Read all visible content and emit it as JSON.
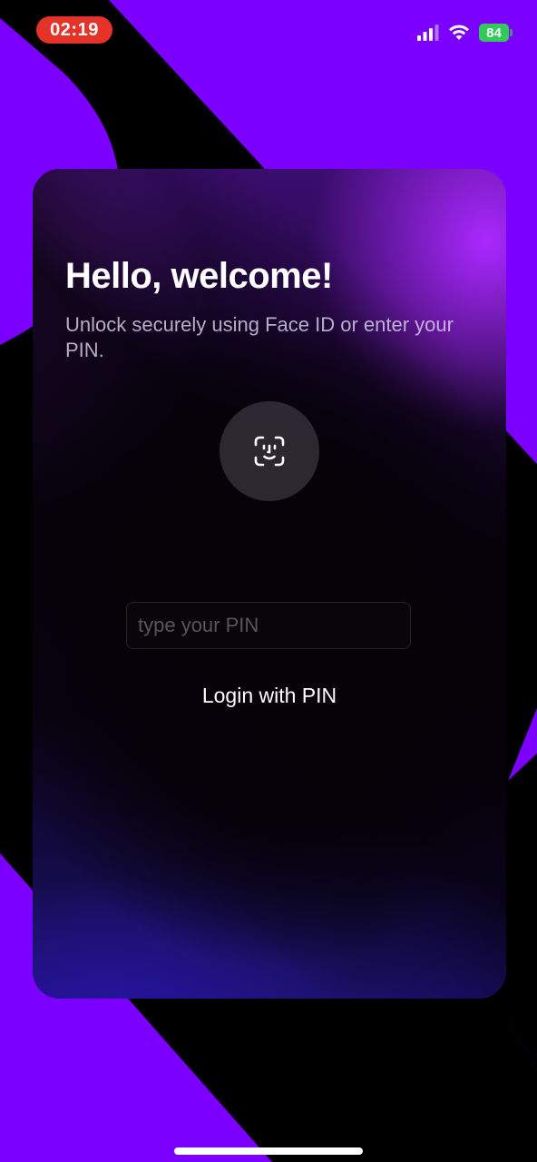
{
  "status_bar": {
    "time": "02:19",
    "battery_level": "84",
    "signal_icon": "cellular-signal-icon",
    "wifi_icon": "wifi-icon",
    "battery_icon": "battery-icon",
    "time_pill_color": "#e5332a",
    "battery_color": "#34c759"
  },
  "login_card": {
    "title": "Hello, welcome!",
    "subtitle": "Unlock securely using Face ID or enter your PIN.",
    "faceid_icon": "face-id-icon",
    "pin_placeholder": "type your PIN",
    "pin_value": "",
    "login_button_label": "Login with PIN"
  },
  "colors": {
    "background_purple": "#7b00ff",
    "background_black": "#000000",
    "text_primary": "#ffffff"
  }
}
